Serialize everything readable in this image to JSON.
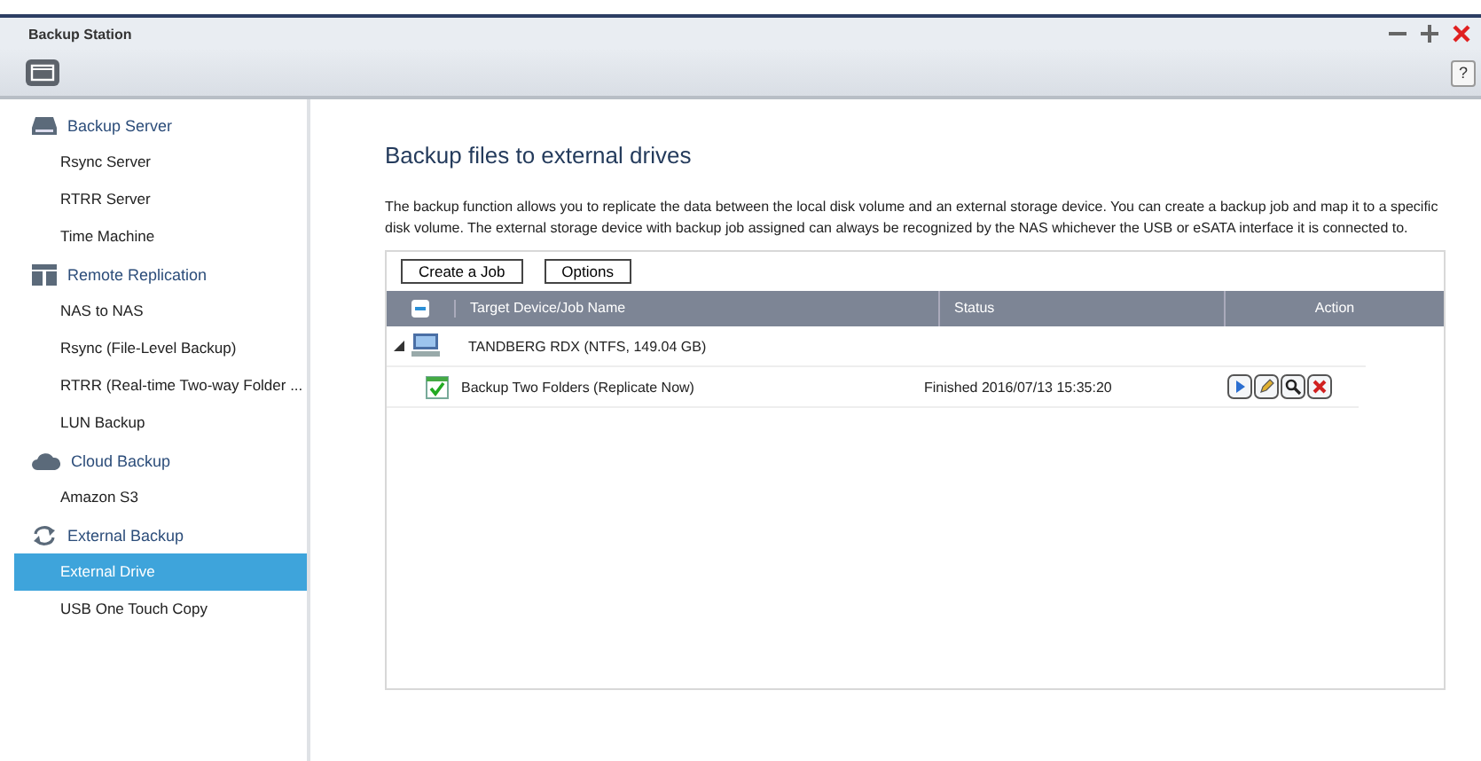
{
  "window": {
    "title": "Backup Station",
    "help": "?"
  },
  "sidebar": {
    "sections": [
      {
        "label": "Backup Server",
        "items": [
          {
            "label": "Rsync Server",
            "selected": false
          },
          {
            "label": "RTRR Server",
            "selected": false
          },
          {
            "label": "Time Machine",
            "selected": false
          }
        ]
      },
      {
        "label": "Remote Replication",
        "items": [
          {
            "label": "NAS to NAS",
            "selected": false
          },
          {
            "label": "Rsync (File-Level Backup)",
            "selected": false
          },
          {
            "label": "RTRR (Real-time Two-way Folder ...",
            "selected": false
          },
          {
            "label": "LUN Backup",
            "selected": false
          }
        ]
      },
      {
        "label": "Cloud Backup",
        "items": [
          {
            "label": "Amazon S3",
            "selected": false
          }
        ]
      },
      {
        "label": "External Backup",
        "items": [
          {
            "label": "External Drive",
            "selected": true
          },
          {
            "label": "USB One Touch Copy",
            "selected": false
          }
        ]
      }
    ]
  },
  "content": {
    "heading": "Backup files to external drives",
    "description": "The backup function allows you to replicate the data between the local disk volume and an external storage device. You can create a backup job and map it to a specific disk volume. The external storage device with backup job assigned can always be recognized by the NAS whichever the USB or eSATA interface it is connected to.",
    "buttons": [
      "Create a Job",
      "Options"
    ],
    "table": {
      "columns": [
        "Target Device/Job Name",
        "Status",
        "Action"
      ],
      "rows": [
        {
          "name": "TANDBERG RDX (NTFS, 149.04 GB)",
          "expanded": true,
          "children": [
            {
              "name": "Backup Two Folders (Replicate Now)",
              "status": "Finished 2016/07/13 15:35:20"
            }
          ]
        }
      ]
    }
  }
}
